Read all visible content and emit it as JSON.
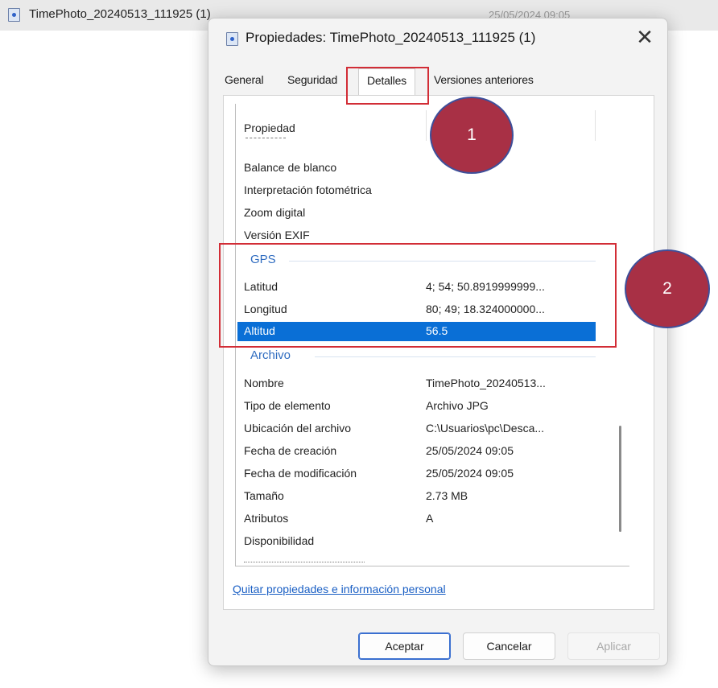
{
  "explorer": {
    "file_name": "TimePhoto_20240513_111925 (1)",
    "file_date": "25/05/2024 09:05"
  },
  "dialog": {
    "title": "Propiedades: TimePhoto_20240513_111925 (1)",
    "close_glyph": "✕",
    "tabs": [
      "General",
      "Seguridad",
      "Detalles",
      "Versiones anteriores"
    ],
    "active_tab": "Detalles",
    "column_header": "Propiedad",
    "rows_top": [
      {
        "name": "Balance de blanco",
        "value": ""
      },
      {
        "name": "Interpretación fotométrica",
        "value": ""
      },
      {
        "name": "Zoom digital",
        "value": ""
      },
      {
        "name": "Versión EXIF",
        "value": ""
      }
    ],
    "gps": {
      "label": "GPS",
      "rows": [
        {
          "name": "Latitud",
          "value": "4; 54; 50.8919999999..."
        },
        {
          "name": "Longitud",
          "value": "80; 49; 18.324000000..."
        },
        {
          "name": "Altitud",
          "value": "56.5"
        }
      ]
    },
    "archivo": {
      "label": "Archivo",
      "rows": [
        {
          "name": "Nombre",
          "value": "TimePhoto_20240513..."
        },
        {
          "name": "Tipo de elemento",
          "value": "Archivo JPG"
        },
        {
          "name": "Ubicación del archivo",
          "value": "C:\\Usuarios\\pc\\Desca..."
        },
        {
          "name": "Fecha de creación",
          "value": "25/05/2024 09:05"
        },
        {
          "name": "Fecha de modificación",
          "value": "25/05/2024 09:05"
        },
        {
          "name": "Tamaño",
          "value": "2.73 MB"
        },
        {
          "name": "Atributos",
          "value": "A"
        },
        {
          "name": "Disponibilidad",
          "value": ""
        }
      ]
    },
    "link_text": "Quitar propiedades e información personal",
    "buttons": {
      "ok": "Aceptar",
      "cancel": "Cancelar",
      "apply": "Aplicar"
    }
  },
  "annotations": {
    "marker_1": "1",
    "marker_2": "2",
    "highlight_color": "#d22d36",
    "marker_color": "#a83045"
  }
}
